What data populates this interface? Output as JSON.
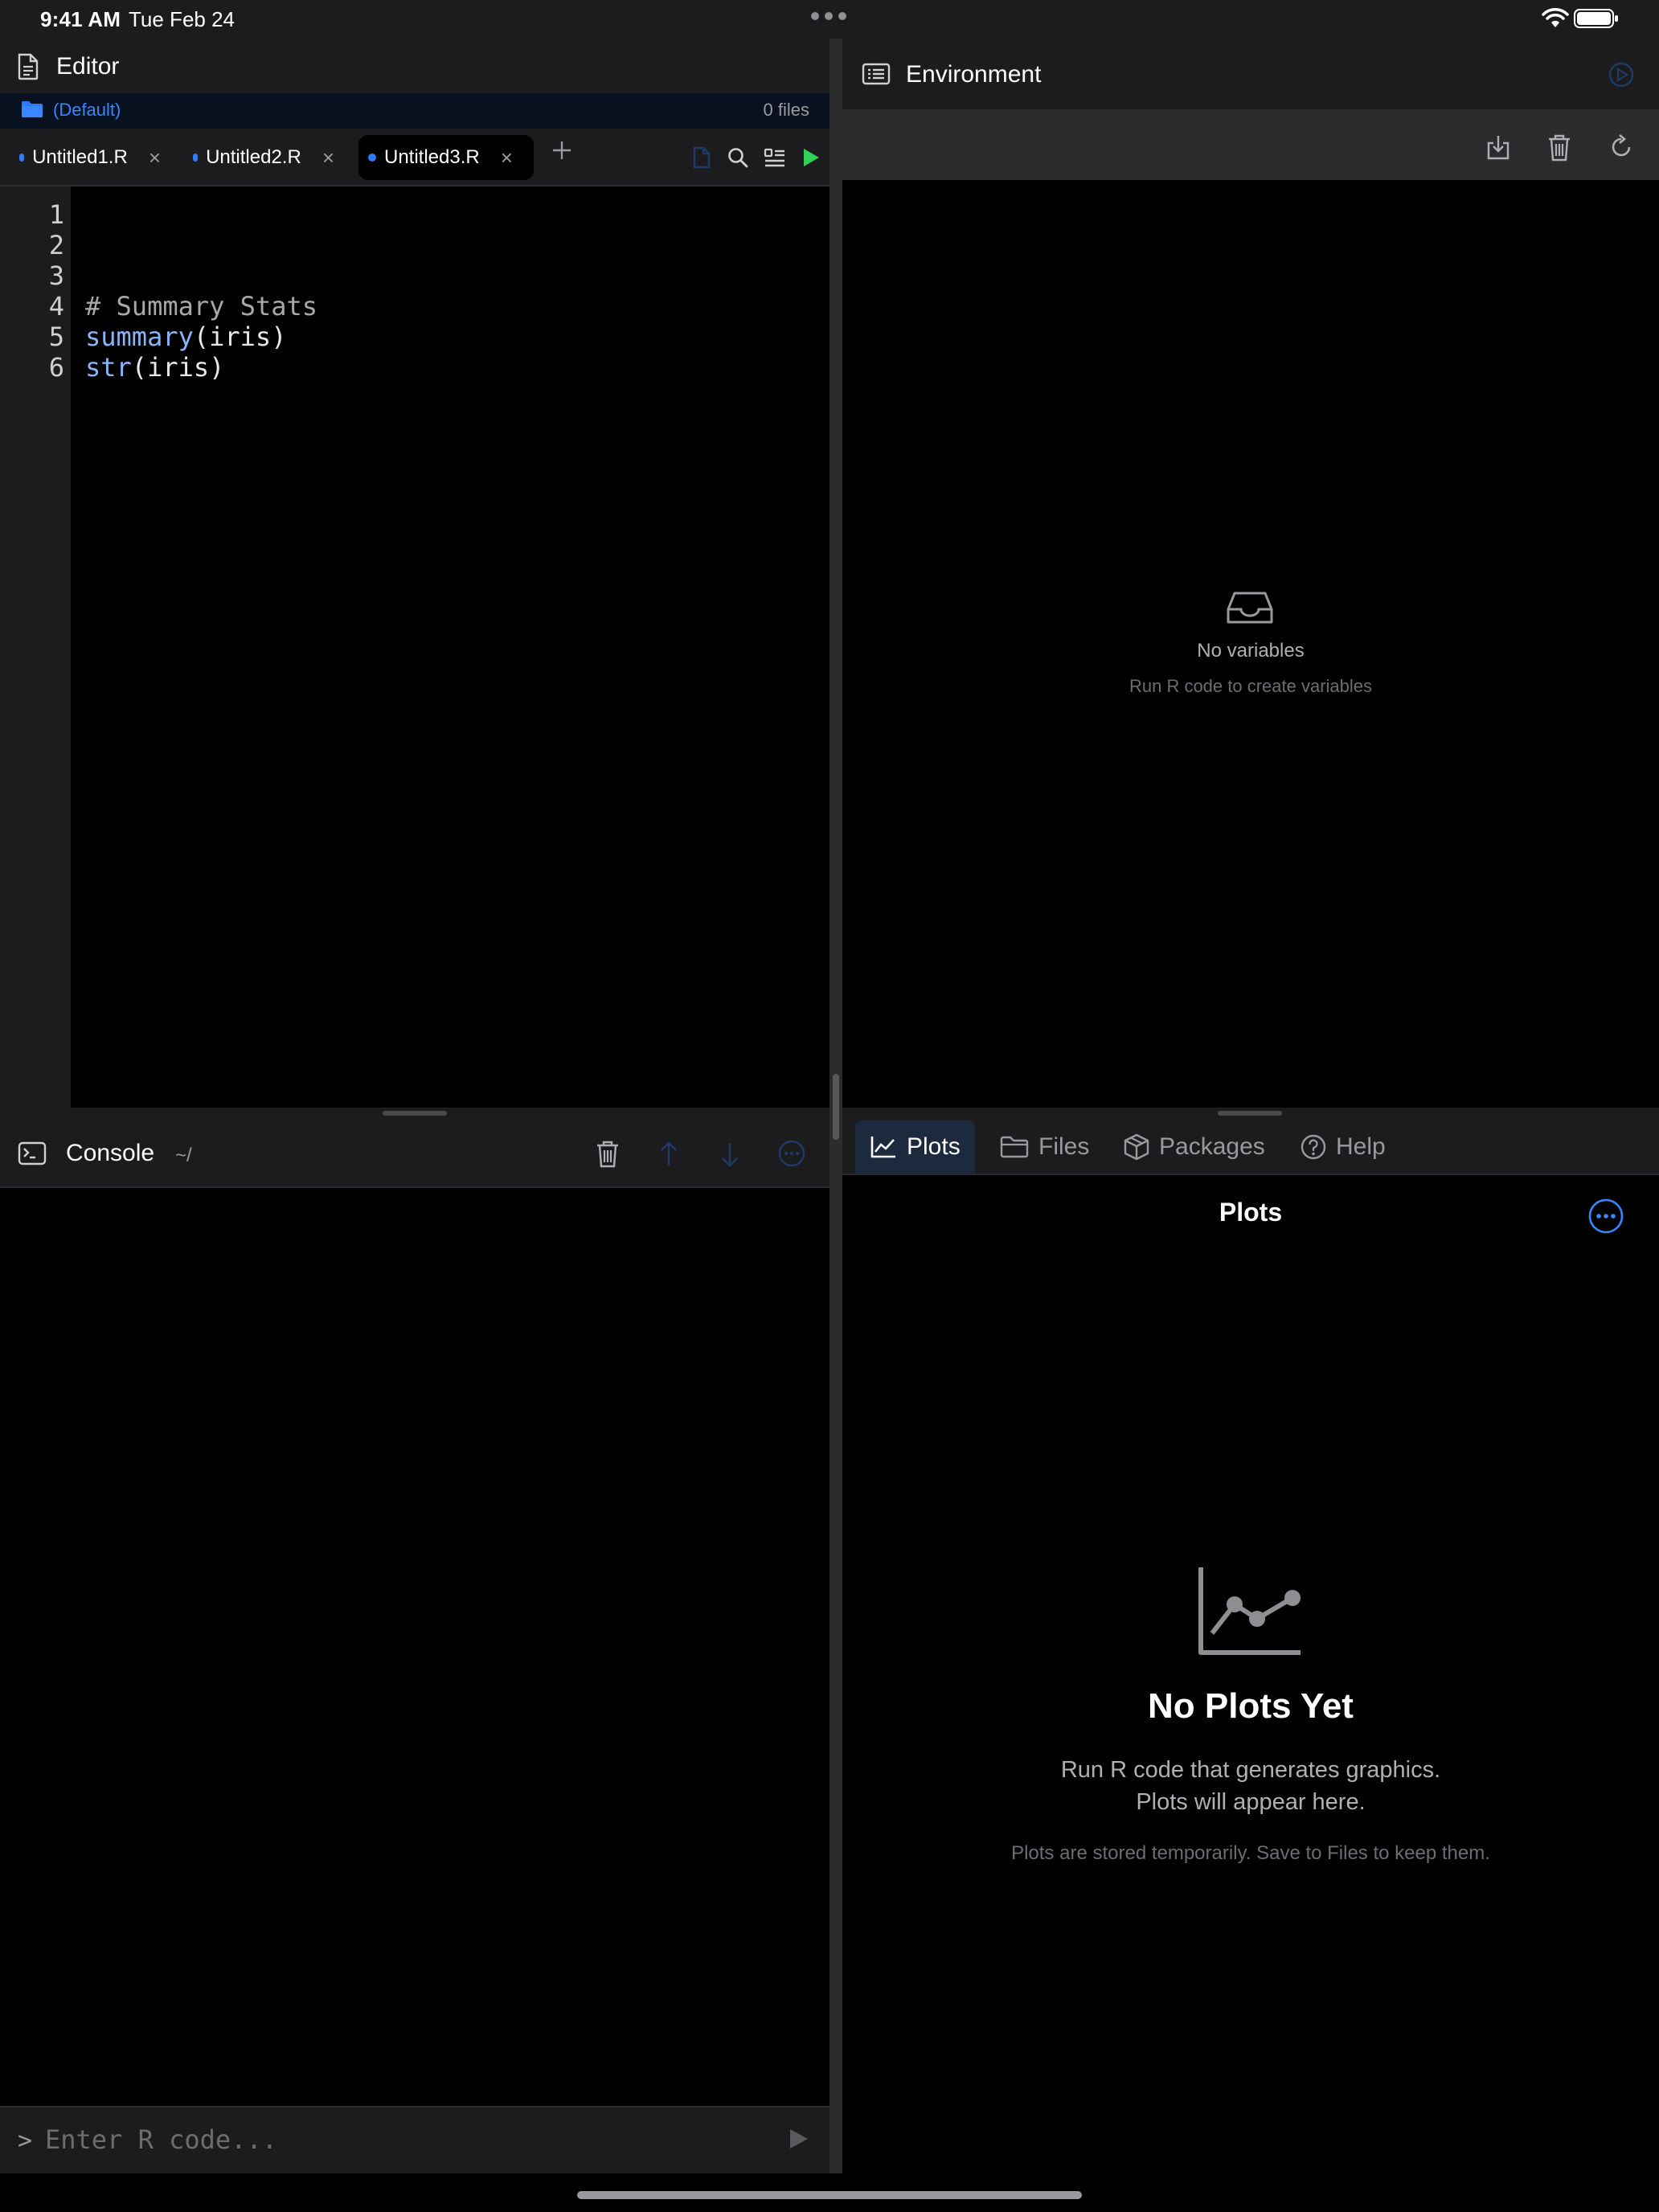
{
  "status_bar": {
    "time": "9:41 AM",
    "date": "Tue Feb 24"
  },
  "editor": {
    "title": "Editor",
    "project": "(Default)",
    "file_count": "0 files",
    "tabs": [
      {
        "label": "Untitled1.R",
        "active": false
      },
      {
        "label": "Untitled2.R",
        "active": false
      },
      {
        "label": "Untitled3.R",
        "active": true
      }
    ],
    "line_numbers": [
      "1",
      "2",
      "3",
      "4",
      "5",
      "6"
    ],
    "code": {
      "line4": "# Summary Stats",
      "line5_fn": "summary",
      "line5_rest": "(iris)",
      "line6_fn": "str",
      "line6_rest": "(iris)"
    }
  },
  "console": {
    "title": "Console",
    "path": "~/",
    "prompt": ">",
    "input_placeholder": "Enter R code...",
    "input_value": ""
  },
  "environment": {
    "title": "Environment",
    "empty_title": "No variables",
    "empty_subtitle": "Run R code to create variables"
  },
  "panel": {
    "tabs": [
      {
        "label": "Plots",
        "icon": "chart-icon",
        "active": true
      },
      {
        "label": "Files",
        "icon": "folder-icon",
        "active": false
      },
      {
        "label": "Packages",
        "icon": "package-icon",
        "active": false
      },
      {
        "label": "Help",
        "icon": "help-icon",
        "active": false
      }
    ],
    "plots_title": "Plots",
    "empty_title": "No Plots Yet",
    "empty_line1": "Run R code that generates graphics.",
    "empty_line2": "Plots will appear here.",
    "footnote": "Plots are stored temporarily. Save to Files to keep them."
  },
  "colors": {
    "accent": "#3a86ff",
    "run": "#30d158",
    "panel_bg": "#1c1c1e",
    "background": "#000000"
  }
}
